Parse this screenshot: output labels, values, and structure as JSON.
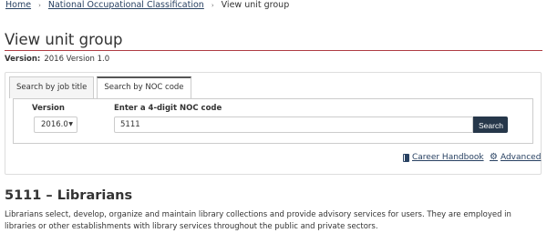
{
  "breadcrumb": {
    "items": [
      "Home",
      "National Occupational Classification"
    ],
    "separator": "›",
    "current": "View unit group"
  },
  "page": {
    "title": "View unit group",
    "version_label": "Version:",
    "version_value": "2016 Version 1.0"
  },
  "search": {
    "tabs": [
      {
        "label": "Search by job title",
        "active": false
      },
      {
        "label": "Search by NOC code",
        "active": true
      }
    ],
    "version_label": "Version",
    "version_selected": "2016.0",
    "noc_label": "Enter a 4-digit NOC code",
    "noc_value": "5111",
    "button_label": "Search"
  },
  "links": {
    "career_handbook": "Career Handbook",
    "advanced": "Advanced"
  },
  "result": {
    "title": "5111 – Librarians",
    "description": "Librarians select, develop, organize and maintain library collections and provide advisory services for users. They are employed in libraries or other establishments with library services throughout the public and private sectors."
  },
  "colors": {
    "link": "#284162",
    "rule": "#af3c43",
    "button_bg": "#26374a"
  },
  "icons": {
    "handbook": "book-icon",
    "advanced": "gear-icon",
    "select": "chevron-down-icon"
  }
}
